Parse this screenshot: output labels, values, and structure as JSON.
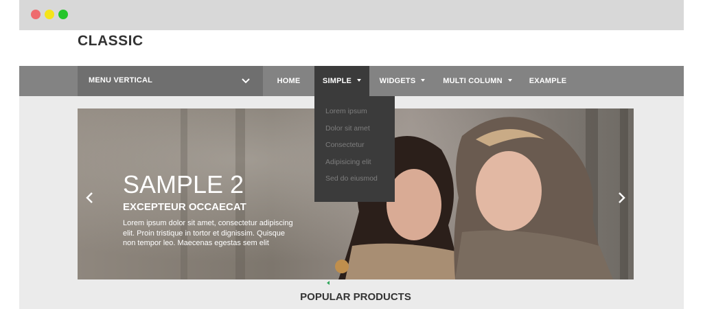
{
  "window": {
    "controls": [
      "close",
      "minimize",
      "maximize"
    ]
  },
  "header": {
    "logo": "CLASSIC"
  },
  "navbar": {
    "vertical_menu_label": "MENU VERTICAL",
    "items": [
      {
        "label": "HOME",
        "has_caret": false,
        "active": false
      },
      {
        "label": "SIMPLE",
        "has_caret": true,
        "active": true
      },
      {
        "label": "WIDGETS",
        "has_caret": true,
        "active": false
      },
      {
        "label": "MULTI COLUMN",
        "has_caret": true,
        "active": false
      },
      {
        "label": "EXAMPLE",
        "has_caret": false,
        "active": false
      }
    ]
  },
  "dropdown": {
    "items": [
      "Lorem ipsum",
      "Dolor sit amet",
      "Consectetur",
      "Adipisicing elit",
      "Sed do eiusmod"
    ]
  },
  "slider": {
    "title": "SAMPLE 2",
    "subtitle": "EXCEPTEUR OCCAECAT",
    "text": "Lorem ipsum dolor sit amet, consectetur adipiscing elit. Proin tristique in tortor et dignissim. Quisque non tempor leo. Maecenas egestas sem elit",
    "prev_icon": "chevron-left-icon",
    "next_icon": "chevron-right-icon"
  },
  "section": {
    "title": "POPULAR PRODUCTS"
  },
  "colors": {
    "navbar": "#838383",
    "vertical_menu": "#6f6f6f",
    "active_menu": "#3b3b3b",
    "close": "#ee6b6e",
    "minimize": "#f5e41a",
    "maximize": "#25c52b",
    "pager_accent": "#2ea55a"
  }
}
